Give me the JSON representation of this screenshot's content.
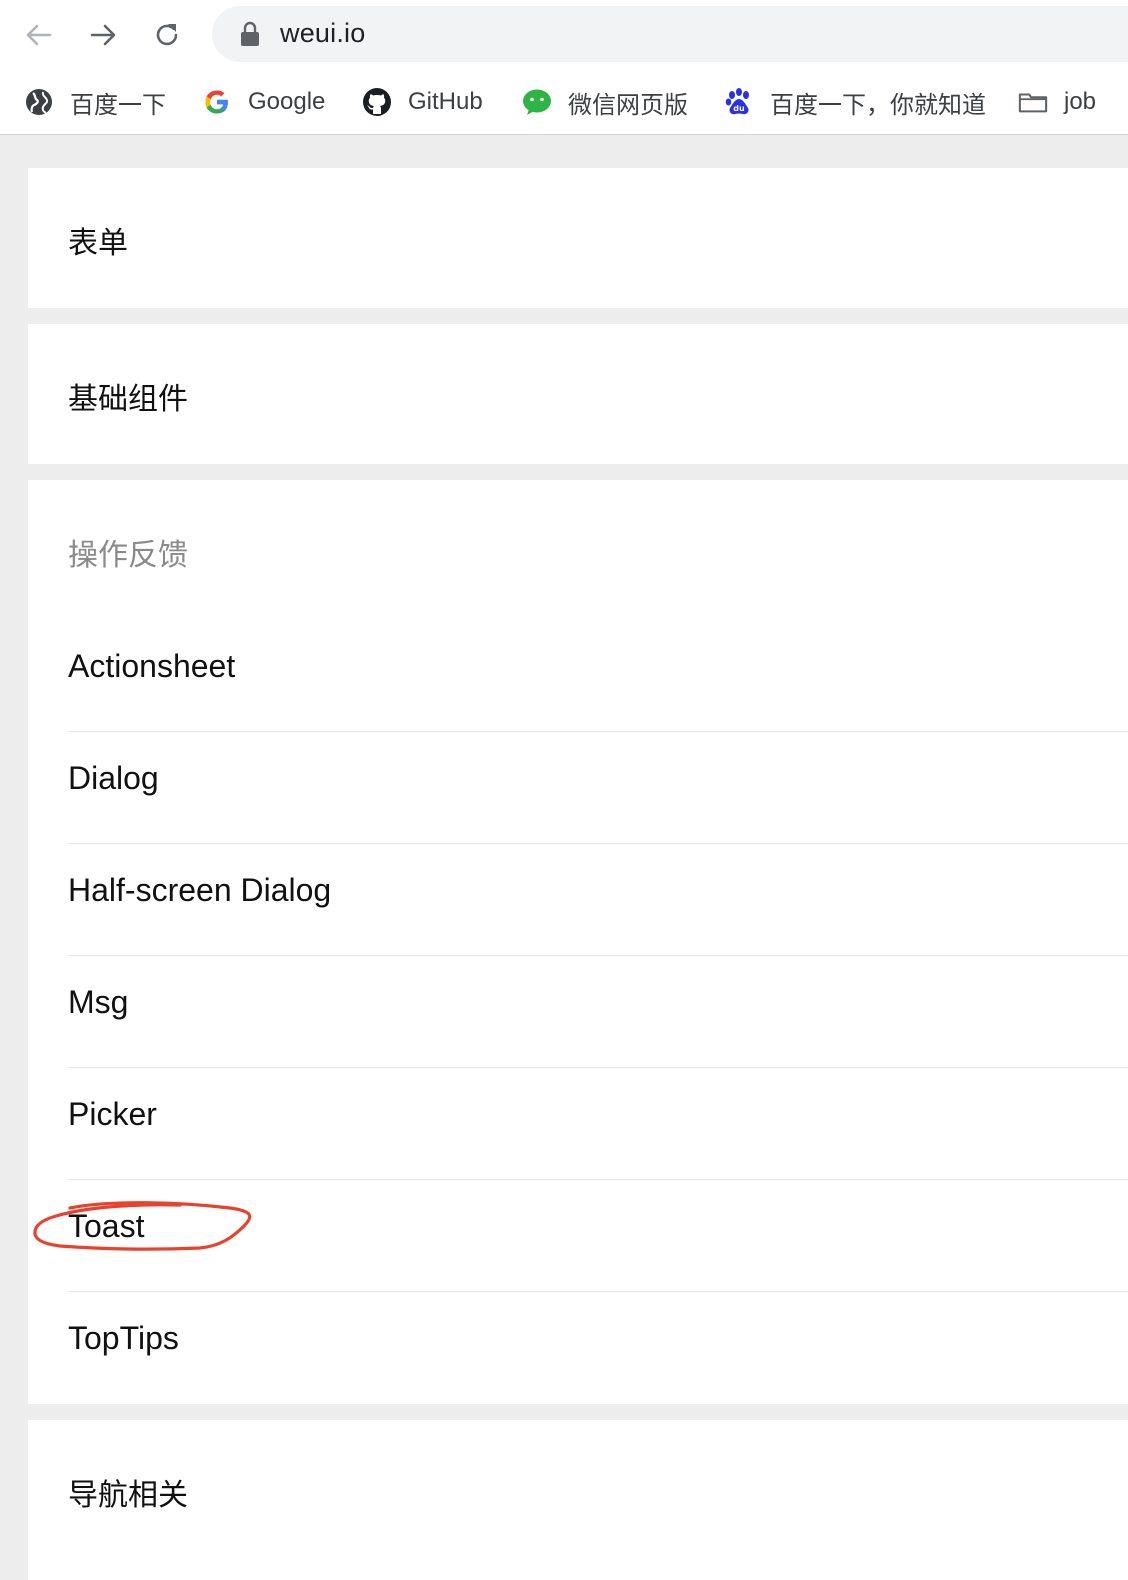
{
  "browser": {
    "url": "weui.io",
    "bookmarks": [
      {
        "label": "百度一下",
        "icon": "globe-icon"
      },
      {
        "label": "Google",
        "icon": "google-icon"
      },
      {
        "label": "GitHub",
        "icon": "github-icon"
      },
      {
        "label": "微信网页版",
        "icon": "wechat-icon"
      },
      {
        "label": "百度一下，你就知道",
        "icon": "baidu-paw-icon"
      },
      {
        "label": "job",
        "icon": "folder-icon"
      }
    ]
  },
  "sections": {
    "form": {
      "title": "表单"
    },
    "basic": {
      "title": "基础组件"
    },
    "feedback": {
      "title": "操作反馈",
      "items": [
        {
          "label": "Actionsheet"
        },
        {
          "label": "Dialog"
        },
        {
          "label": "Half-screen Dialog"
        },
        {
          "label": "Msg"
        },
        {
          "label": "Picker"
        },
        {
          "label": "Toast"
        },
        {
          "label": "TopTips"
        }
      ]
    },
    "navigation": {
      "title": "导航相关"
    }
  },
  "annotation": {
    "color": "#e8412c",
    "target": "Toast"
  }
}
